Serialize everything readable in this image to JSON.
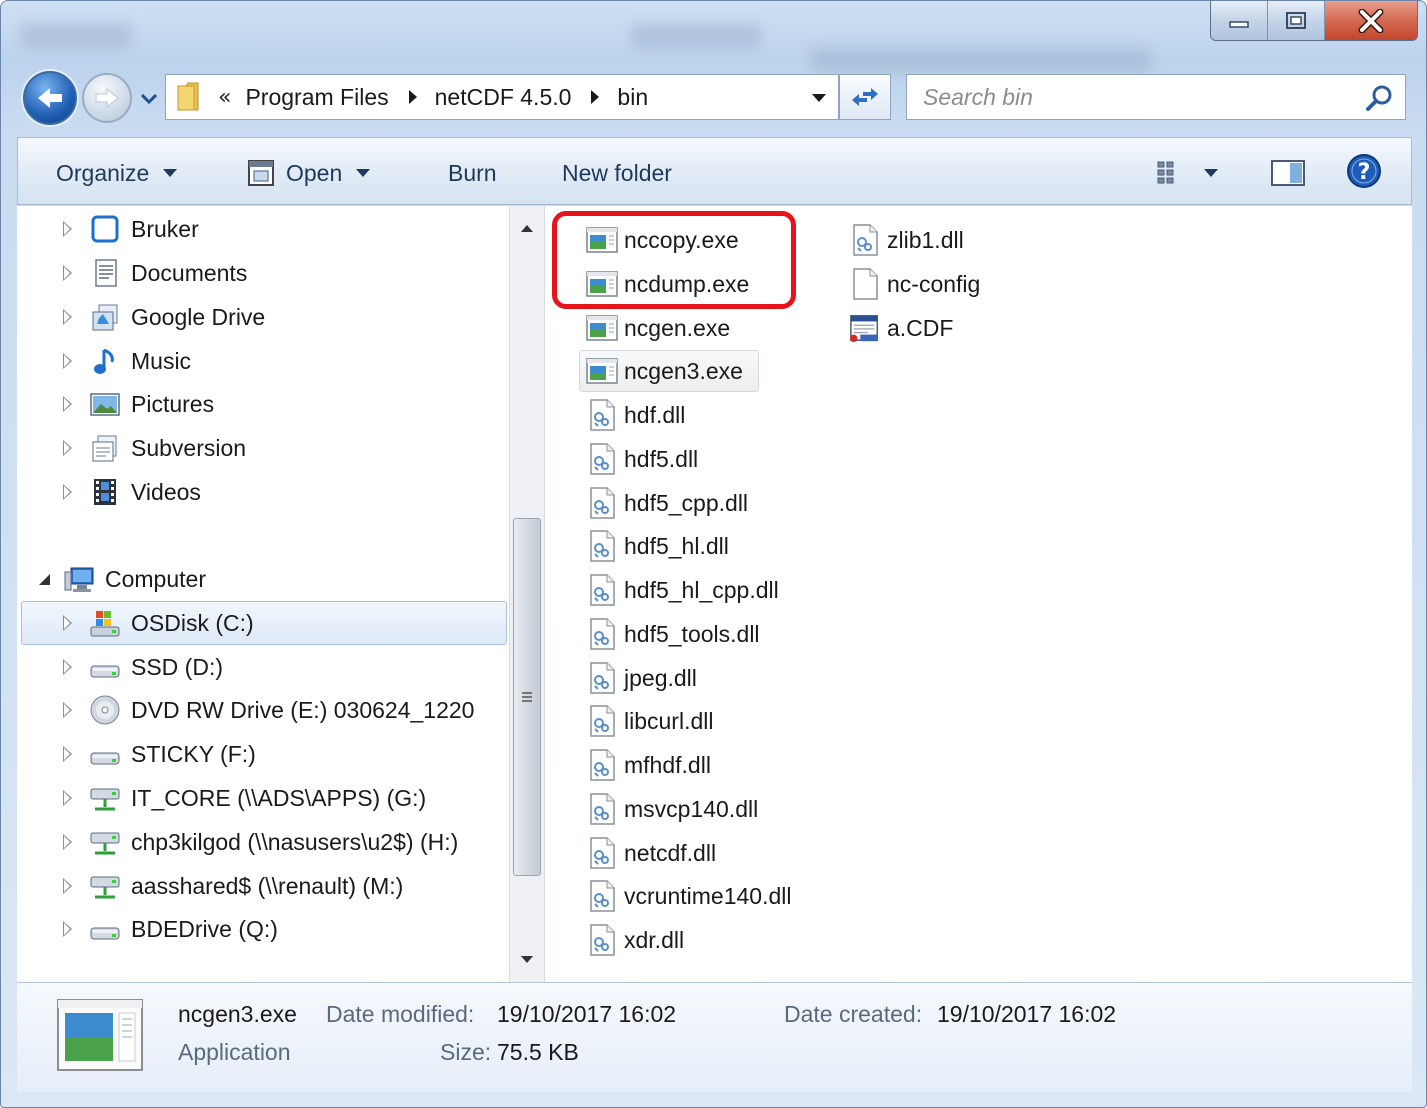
{
  "address": {
    "chevron": "«",
    "crumbs": [
      "Program Files",
      "netCDF 4.5.0",
      "bin"
    ]
  },
  "search": {
    "placeholder": "Search bin"
  },
  "toolbar": {
    "organize": "Organize",
    "open": "Open",
    "burn": "Burn",
    "new_folder": "New folder"
  },
  "nav": {
    "libraries": [
      "Bruker",
      "Documents",
      "Google Drive",
      "Music",
      "Pictures",
      "Subversion",
      "Videos"
    ],
    "computer": "Computer",
    "drives": [
      "OSDisk (C:)",
      "SSD (D:)",
      "DVD RW Drive (E:) 030624_1220",
      "STICKY (F:)",
      "IT_CORE (\\\\ADS\\APPS) (G:)",
      "chp3kilgod (\\\\nasusers\\u2$) (H:)",
      "aasshared$ (\\\\renault) (M:)",
      "BDEDrive (Q:)"
    ],
    "selected": "OSDisk (C:)"
  },
  "files": {
    "column1": [
      "nccopy.exe",
      "ncdump.exe",
      "ncgen.exe",
      "ncgen3.exe",
      "hdf.dll",
      "hdf5.dll",
      "hdf5_cpp.dll",
      "hdf5_hl.dll",
      "hdf5_hl_cpp.dll",
      "hdf5_tools.dll",
      "jpeg.dll",
      "libcurl.dll",
      "mfhdf.dll",
      "msvcp140.dll",
      "netcdf.dll",
      "vcruntime140.dll",
      "xdr.dll"
    ],
    "column2": [
      "zlib1.dll",
      "nc-config",
      "a.CDF"
    ],
    "hovered": "ncgen3.exe"
  },
  "details": {
    "name": "ncgen3.exe",
    "type": "Application",
    "date_modified_label": "Date modified:",
    "date_modified": "19/10/2017 16:02",
    "date_created_label": "Date created:",
    "date_created": "19/10/2017 16:02",
    "size_label": "Size:",
    "size": "75.5 KB"
  },
  "colors": {
    "highlight": "#e8141c",
    "command_text": "#1e395b"
  }
}
